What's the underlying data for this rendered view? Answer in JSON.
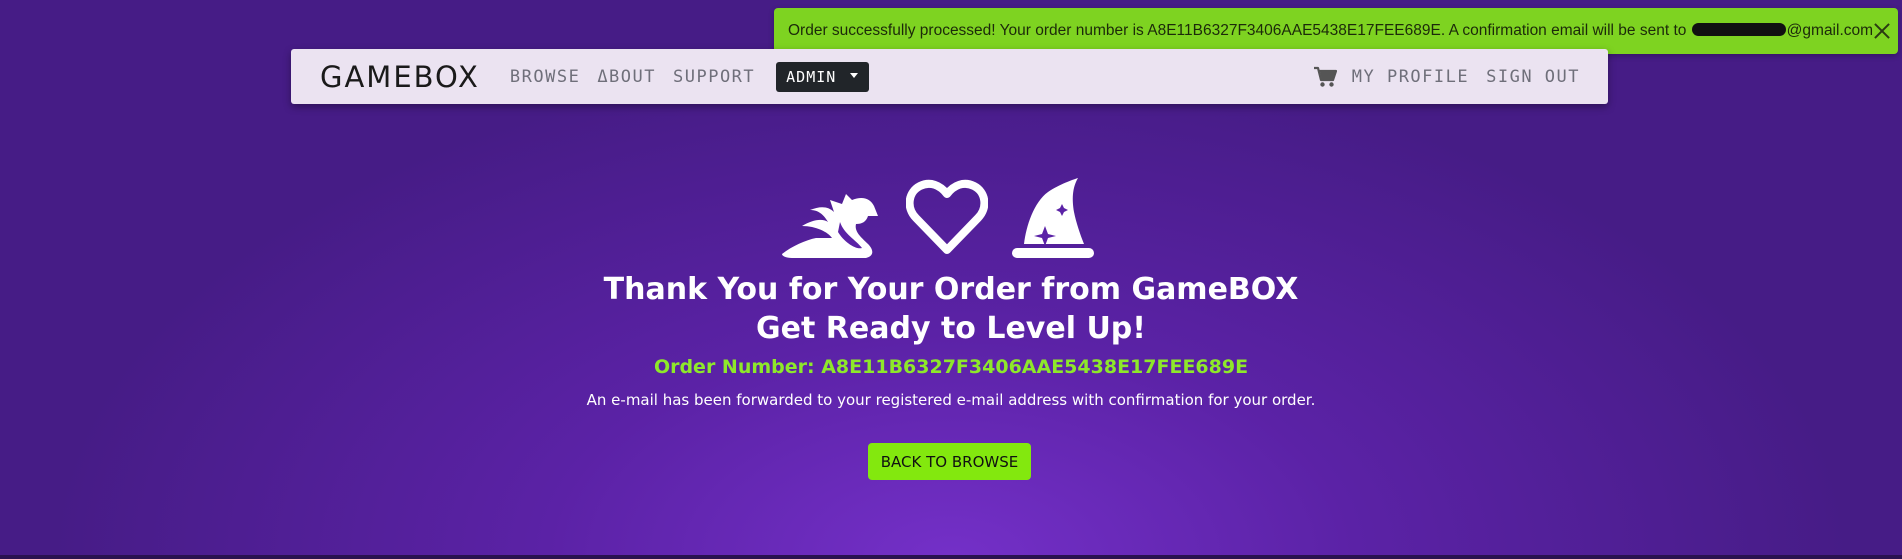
{
  "toast": {
    "message_prefix": "Order successfully processed! Your order number is A8E11B6327F3406AAE5438E17FEE689E. A confirmation email will be sent to ",
    "email_domain": "@gmail.com",
    "background": "#7ed321"
  },
  "navbar": {
    "brand": "GAMEBOX",
    "links": [
      "BROWSE",
      "ΔBOUT",
      "SUPPORT"
    ],
    "admin_label": "ADMIN",
    "right_links": [
      "MY PROFILE",
      "SIGN OUT"
    ],
    "cart_icon": "shopping-cart-icon"
  },
  "hero": {
    "icons": [
      "dragon-icon",
      "heart-icon",
      "wizard-hat-icon"
    ],
    "title_line1": "Thank You for Your Order from GameBOX",
    "title_line2": "Get Ready to Level Up!",
    "order_number": "Order Number: A8E11B6327F3406AAE5438E17FEE689E",
    "note": "An e-mail has been forwarded to your registered e-mail address with confirmation for your order.",
    "button_label": "BACK TO BROWSE"
  },
  "colors": {
    "accent": "#83e80e",
    "background_purple": "#5b22a6",
    "navbar_bg": "#ebe3f1"
  }
}
